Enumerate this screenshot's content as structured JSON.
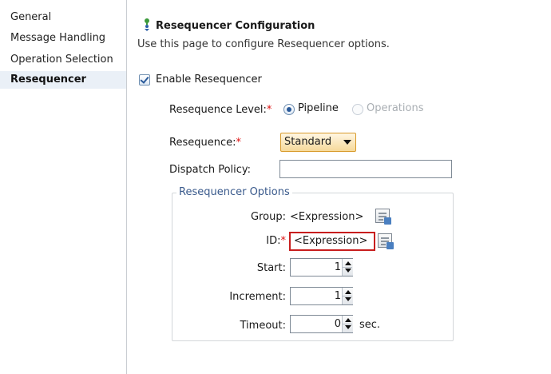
{
  "nav": {
    "items": [
      {
        "label": "General",
        "selected": false
      },
      {
        "label": "Message Handling",
        "selected": false
      },
      {
        "label": "Operation Selection",
        "selected": false
      },
      {
        "label": "Resequencer",
        "selected": true
      }
    ]
  },
  "header": {
    "title": "Resequencer Configuration",
    "description": "Use this page to configure Resequencer options.",
    "icon": "config-icon"
  },
  "enable": {
    "label": "Enable Resequencer",
    "checked": true
  },
  "level": {
    "label": "Resequence Level:",
    "required_mark": "*",
    "options": [
      {
        "label": "Pipeline",
        "selected": true,
        "enabled": true
      },
      {
        "label": "Operations",
        "selected": false,
        "enabled": false
      }
    ]
  },
  "resequence": {
    "label": "Resequence:",
    "required_mark": "*",
    "value": "Standard"
  },
  "dispatch": {
    "label": "Dispatch Policy:",
    "value": ""
  },
  "options_group": {
    "title": "Resequencer Options",
    "group": {
      "label": "Group:",
      "value": "<Expression>"
    },
    "id": {
      "label": "ID:",
      "required_mark": "*",
      "value": "<Expression>"
    },
    "start": {
      "label": "Start:",
      "value": "1"
    },
    "increment": {
      "label": "Increment:",
      "value": "1"
    },
    "timeout": {
      "label": "Timeout:",
      "value": "0",
      "unit": "sec."
    }
  },
  "colors": {
    "required": "#dd1111",
    "error_border": "#c81e1e",
    "selection_bg": "#eaf0f7",
    "select_accent": "#f6d99a"
  }
}
